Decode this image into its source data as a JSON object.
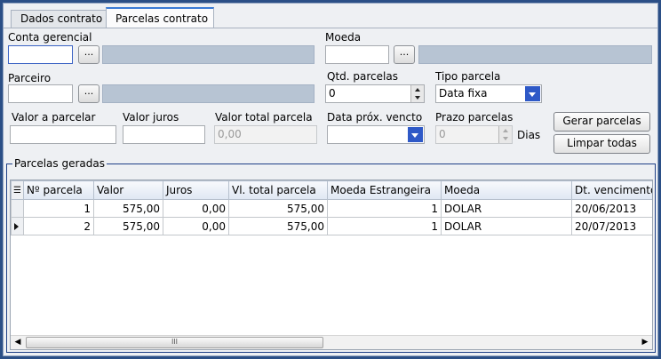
{
  "tabs": [
    "Dados contrato",
    "Parcelas contrato"
  ],
  "form": {
    "conta_gerencial_label": "Conta gerencial",
    "moeda_label": "Moeda",
    "parceiro_label": "Parceiro",
    "qtd_parcelas_label": "Qtd. parcelas",
    "qtd_parcelas_value": "0",
    "tipo_parcela_label": "Tipo parcela",
    "tipo_parcela_value": "Data fixa",
    "valor_a_parcelar_label": "Valor a parcelar",
    "valor_juros_label": "Valor juros",
    "valor_total_parcela_label": "Valor total parcela",
    "valor_total_parcela_value": "0,00",
    "data_prox_vencto_label": "Data próx. vencto",
    "prazo_parcelas_label": "Prazo parcelas",
    "prazo_parcelas_value": "0",
    "dias_label": "Dias",
    "ellipsis": "..."
  },
  "buttons": {
    "gerar": "Gerar parcelas",
    "limpar": "Limpar todas"
  },
  "group": {
    "title": "Parcelas geradas",
    "columns": [
      "Nº parcela",
      "Valor",
      "Juros",
      "Vl. total parcela",
      "Moeda Estrangeira",
      "Moeda",
      "Dt. vencimento"
    ],
    "rows": [
      {
        "numero": "1",
        "valor": "575,00",
        "juros": "0,00",
        "total": "575,00",
        "moeda_estrangeira": "1",
        "moeda": "DOLAR",
        "vencimento": "20/06/2013"
      },
      {
        "numero": "2",
        "valor": "575,00",
        "juros": "0,00",
        "total": "575,00",
        "moeda_estrangeira": "1",
        "moeda": "DOLAR",
        "vencimento": "20/07/2013"
      }
    ],
    "scroll_thumb": "III"
  }
}
